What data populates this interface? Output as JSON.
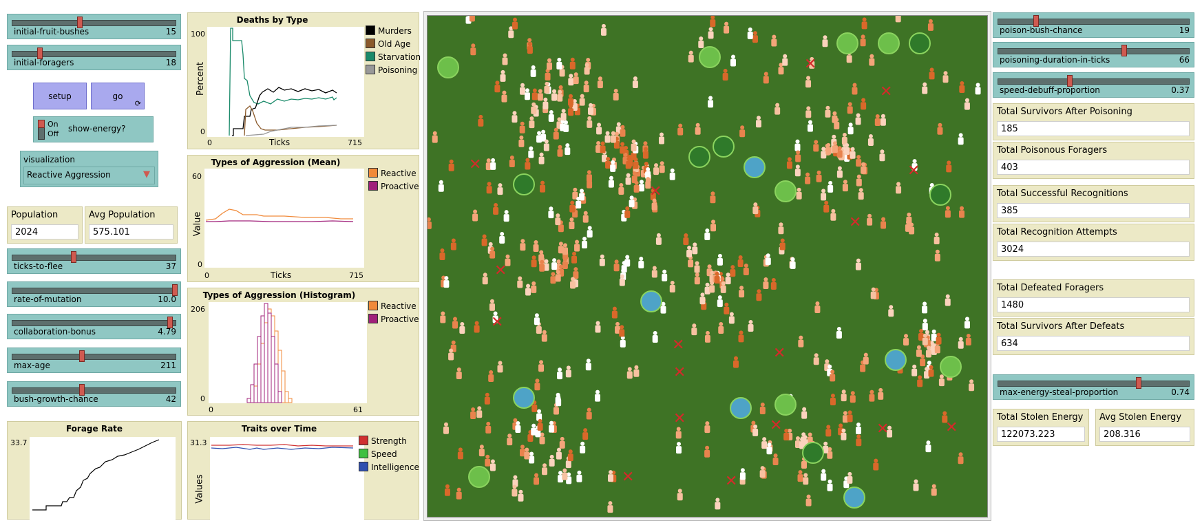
{
  "colors": {
    "slider": "#8fc7c3",
    "button": "#a9a9ee",
    "monitor": "#ece9c6",
    "world": "#3e7325"
  },
  "left_sliders": [
    {
      "label": "initial-fruit-bushes",
      "value": "15",
      "fraction": 0.44
    },
    {
      "label": "initial-foragers",
      "value": "18",
      "fraction": 0.18
    }
  ],
  "buttons": {
    "setup": "setup",
    "go": "go"
  },
  "switch": {
    "on": "On",
    "off": "Off",
    "label": "show-energy?"
  },
  "chooser": {
    "label": "visualization",
    "value": "Reactive Aggression"
  },
  "monitors_left": [
    {
      "title": "Population",
      "value": "2024"
    },
    {
      "title": "Avg Population",
      "value": "575.101"
    }
  ],
  "left_sliders2": [
    {
      "label": "ticks-to-flee",
      "value": "37",
      "fraction": 0.37
    },
    {
      "label": "rate-of-mutation",
      "value": "10.0",
      "fraction": 1.0
    },
    {
      "label": "collaboration-bonus",
      "value": "4.79",
      "fraction": 0.97
    },
    {
      "label": "max-age",
      "value": "211",
      "fraction": 0.42
    },
    {
      "label": "bush-growth-chance",
      "value": "42",
      "fraction": 0.42
    }
  ],
  "forage_plot": {
    "title": "Forage Rate",
    "ymax": "33.7"
  },
  "deaths_plot": {
    "title": "Deaths by Type",
    "ylabel": "Percent",
    "xlabel": "Ticks",
    "ymax": "100",
    "ymin": "0",
    "xmin": "0",
    "xmax": "715",
    "legend": [
      {
        "name": "Murders",
        "color": "#000000"
      },
      {
        "name": "Old Age",
        "color": "#8b5a2b"
      },
      {
        "name": "Starvation",
        "color": "#1a8a6a"
      },
      {
        "name": "Poisoning",
        "color": "#999999"
      }
    ]
  },
  "aggr_mean_plot": {
    "title": "Types of Aggression (Mean)",
    "ylabel": "Value",
    "xlabel": "Ticks",
    "ymax": "60",
    "ymin": "0",
    "xmin": "0",
    "xmax": "715",
    "legend": [
      {
        "name": "Reactive",
        "color": "#f08a3a"
      },
      {
        "name": "Proactive",
        "color": "#a0207a"
      }
    ]
  },
  "aggr_hist_plot": {
    "title": "Types of Aggression (Histogram)",
    "ymax": "206",
    "ymin": "0",
    "xmin": "0",
    "xmax": "61",
    "legend": [
      {
        "name": "Reactive",
        "color": "#f08a3a"
      },
      {
        "name": "Proactive",
        "color": "#a0207a"
      }
    ]
  },
  "traits_plot": {
    "title": "Traits over Time",
    "ylabel": "Values",
    "ymax": "31.3",
    "legend": [
      {
        "name": "Strength",
        "color": "#d03030"
      },
      {
        "name": "Speed",
        "color": "#40c040"
      },
      {
        "name": "Intelligence",
        "color": "#3050b0"
      }
    ]
  },
  "right_sliders": [
    {
      "label": "poison-bush-chance",
      "value": "19",
      "fraction": 0.19
    },
    {
      "label": "poisoning-duration-in-ticks",
      "value": "66",
      "fraction": 0.66
    },
    {
      "label": "speed-debuff-proportion",
      "value": "0.37",
      "fraction": 0.37
    }
  ],
  "monitors_right": [
    {
      "title": "Total Survivors After Poisoning",
      "value": "185"
    },
    {
      "title": "Total Poisonous Foragers",
      "value": "403"
    },
    {
      "title": "Total Successful Recognitions",
      "value": "385"
    },
    {
      "title": "Total Recognition Attempts",
      "value": "3024"
    },
    {
      "title": "Total Defeated Foragers",
      "value": "1480"
    },
    {
      "title": "Total Survivors After Defeats",
      "value": "634"
    }
  ],
  "steal_slider": {
    "label": "max-energy-steal-proportion",
    "value": "0.74",
    "fraction": 0.74
  },
  "monitors_bottom": [
    {
      "title": "Total Stolen Energy",
      "value": "122073.223"
    },
    {
      "title": "Avg Stolen Energy",
      "value": "208.316"
    }
  ]
}
